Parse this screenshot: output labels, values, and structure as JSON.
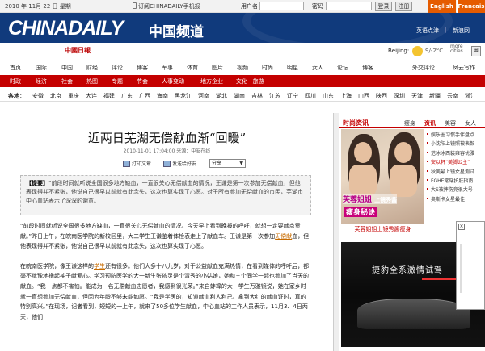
{
  "topbar": {
    "date": "2010 年 11月 22 日 星期一",
    "subscribe": "订阅CHINADAILY手机报",
    "username_label": "用户名",
    "password_label": "密码",
    "login_btn": "登录",
    "register_btn": "注册",
    "lang_en": "English",
    "lang_fr": "Français"
  },
  "banner": {
    "logo": "CHINADAILY",
    "channel": "中国频道",
    "link1": "英语点津",
    "link2": "新浪网"
  },
  "weather": {
    "mark": "中國日報",
    "city": "Beijing:",
    "temp": "9/-2°C",
    "more": "more cities",
    "ctrl": "⊞"
  },
  "nav1": [
    "首页",
    "国际",
    "中国",
    "财经",
    "评论",
    "博客",
    "军事",
    "体育",
    "图片",
    "视频",
    "时尚",
    "明星",
    "女人",
    "论坛",
    "博客"
  ],
  "nav1_right": "外交评论",
  "nav1_right2": "凤云写作",
  "nav2": [
    "时政",
    "经济",
    "社会",
    "热图",
    "专题",
    "节会",
    "人事变动",
    "地方企业",
    "文化 · 旅游"
  ],
  "nav3_label": "各地：",
  "nav3": [
    "安徽",
    "北京",
    "重庆",
    "大连",
    "福建",
    "广东",
    "广西",
    "海南",
    "黑龙江",
    "河南",
    "湖北",
    "湖南",
    "吉林",
    "江苏",
    "辽宁",
    "四川",
    "山东",
    "上海",
    "山西",
    "陕西",
    "深圳",
    "天津",
    "新疆",
    "云南",
    "浙江"
  ],
  "article": {
    "title": "近两日芜湖无偿献血渐“回暖”",
    "meta": "2010-11-01 17:04:00  来源：中安在线",
    "print": "打印文章",
    "send": "发送给好友",
    "share": "分享",
    "summary_tag": "【提要】",
    "summary": "“前段时间就听说全国很多地方缺血，一直很关心无偿献血的情况，王谦是第一次参加无偿献血，但他表现得并不紧张，他说自己很早以前就有此念头，这次也算实现了心愿。对于所有参加无偿献血的市民，芜湖市中心血站表示了深深的谢意。",
    "p1a": "“前段时间就听说全国很多地方缺血，一直很关心无偿献血的情况。今天早上看到晚报的呼吁，就想一定要献点贡献。”昨日上午，在皖南医学院的新校区里，大二学生王谦鉴着体检表走上了献血车。王谦是第一次参加",
    "p1link": "无偿献",
    "p1b": "血，但他表现得并不紧张，他说自己很早以前就有此念头，这次也算实现了心愿。",
    "p2a": "在皖南医学院，像王谦这样的",
    "p2link": "学生",
    "p2b": "还有很多。他们大多十八九岁，对于公益献血充满热情，在看到媒体的呼吁后，都毫不犹豫地撸起袖子献爱心。学习预防医学的大一新生张依灵是个清秀的小姑娘，她和三个同学一起也参加了当天的献血。“我一点都不害怕。能成为一名无偿献血志愿者，我感到很光荣。”来自蚌埠的大一学生万雅镜说，她在家乡时就一直想参加无偿献血，但因为年龄不够未能如愿。“我是学医的，知道献血利人利己。拿到大红的献血证时，真的特别高兴。”在现场，记者看到，短短的一上午，就来了50多位学生献血，中心血站的工作人员表示，11月3、4日两天，他们"
  },
  "sidebar": {
    "title": "时尚资讯",
    "tabs": [
      "瘦身",
      "资讯",
      "美容",
      "女人"
    ],
    "active_tab": 1,
    "promo_cap1": "芙蓉姐姐",
    "promo_cap1b": "上镜秀酱",
    "promo_cap2": "瘦身秘诀",
    "promo_caption": "芙蓉姐姐上镜秀酱瘦身",
    "list": [
      "娱乐圈习惯手伴盘点",
      "小沈阳上镜照被表彰",
      "范冰冰西装雍容优雅",
      "安以轩“美脚公主”",
      "秋美最上镜女星测试",
      "FGHE常穿护肤指南",
      "大S被摔伤竟很大号",
      "奥斯卡女星最佳"
    ],
    "ad_text": "捷豹全系激情试驾"
  },
  "popup": {
    "close": "×"
  }
}
